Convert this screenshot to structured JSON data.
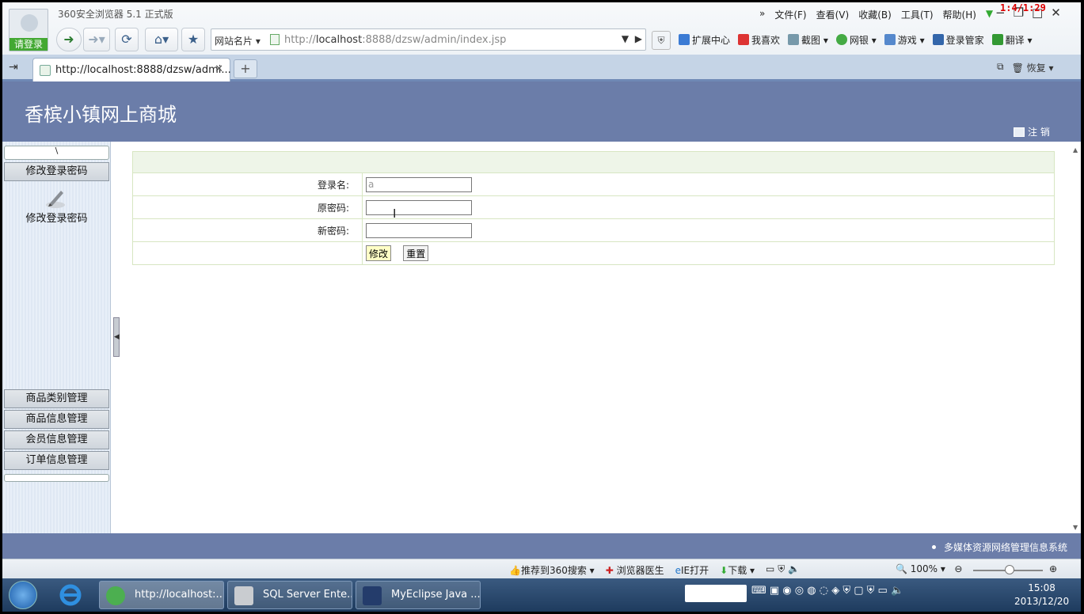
{
  "browser": {
    "app_title": "360安全浏览器 5.1 正式版",
    "login_tag": "请登录",
    "menu": [
      "文件(F)",
      "查看(V)",
      "收藏(B)",
      "工具(T)",
      "帮助(H)"
    ],
    "counter": "1:4/1:29",
    "site_card": "网站名片",
    "url_prefix": "http://",
    "url_host": "localhost",
    "url_rest": ":8888/dzsw/admin/index.jsp",
    "toolbar_links": [
      "扩展中心",
      "我喜欢",
      "截图",
      "网银",
      "游戏",
      "登录管家",
      "翻译"
    ],
    "tab_title": "http://localhost:8888/dzsw/admi...",
    "tab_right": "恢复"
  },
  "page": {
    "site_title": "香槟小镇网上商城",
    "logout": "注 销",
    "panel_head": "\\",
    "menu_active_header": "修改登录密码",
    "menu_active_item": "修改登录密码",
    "menu_headers": [
      "商品类别管理",
      "商品信息管理",
      "会员信息管理",
      "订单信息管理"
    ],
    "form": {
      "login_label": "登录名:",
      "login_value": "a",
      "old_pwd_label": "原密码:",
      "new_pwd_label": "新密码:",
      "submit": "修改",
      "reset": "重置"
    },
    "footer": "多媒体资源网络管理信息系统"
  },
  "statusbar": {
    "items": [
      "推荐到360搜索",
      "浏览器医生",
      "IE打开",
      "下载"
    ],
    "zoom": "100%"
  },
  "taskbar": {
    "items": [
      "http://localhost:...",
      "SQL Server Ente...",
      "MyEclipse Java ..."
    ],
    "time": "15:08",
    "date": "2013/12/20"
  },
  "colors": {
    "header_blue": "#6b7da9",
    "form_border": "#d7e6c2",
    "login_green": "#43a832"
  }
}
